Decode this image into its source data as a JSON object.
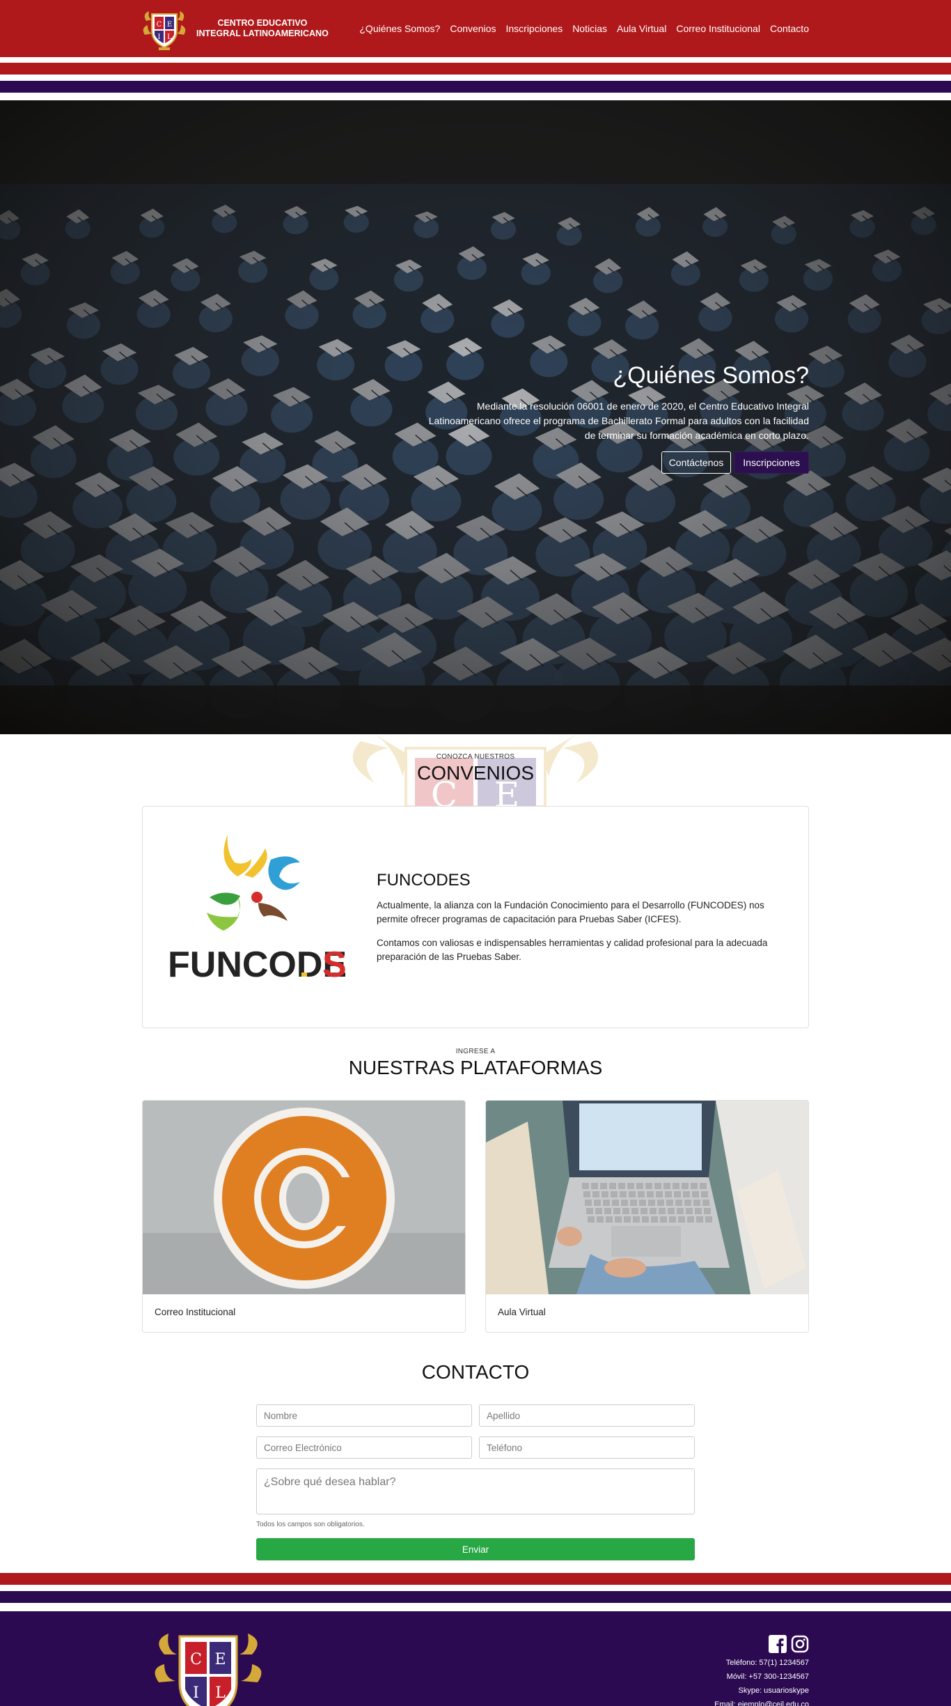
{
  "brand": {
    "name_line1": "CENTRO EDUCATIVO",
    "name_line2": "INTEGRAL LATINOAMERICANO",
    "crest_letters": [
      "C",
      "E",
      "I",
      "L"
    ]
  },
  "nav": {
    "items": [
      {
        "label": "¿Quiénes Somos?"
      },
      {
        "label": "Convenios"
      },
      {
        "label": "Inscripciones"
      },
      {
        "label": "Noticias"
      },
      {
        "label": "Aula Virtual"
      },
      {
        "label": "Correo Institucional"
      },
      {
        "label": "Contacto"
      }
    ]
  },
  "colors": {
    "primary_red": "#b0191b",
    "primary_purple": "#2b0f4f",
    "success_green": "#28a745"
  },
  "hero": {
    "title": "¿Quiénes Somos?",
    "text": "Mediante la resolución 06001 de enero de 2020, el Centro Educativo Integral Latinoamericano ofrece el programa de Bachillerato Formal para adultos con la facilidad de terminar su formación académica en corto plazo.",
    "button_contact": "Contáctenos",
    "button_register": "Inscripciones"
  },
  "convenios": {
    "kicker": "CONOZCA NUESTROS",
    "title": "CONVENIOS",
    "card": {
      "logo_text_main": "FUNCODE",
      "logo_text_s": "S",
      "heading": "FUNCODES",
      "paragraph1": "Actualmente, la alianza con la Fundación Conocimiento para el Desarrollo (FUNCODES) nos permite ofrecer programas de capacitación para Pruebas Saber (ICFES).",
      "paragraph2": "Contamos con valiosas e indispensables herramientas y calidad profesional para la adecuada preparación de las Pruebas Saber."
    }
  },
  "plataformas": {
    "kicker": "INGRESE A",
    "title": "NUESTRAS PLATAFORMAS",
    "cards": [
      {
        "label": "Correo Institucional",
        "image": "at-sign-icon"
      },
      {
        "label": "Aula Virtual",
        "image": "laptop-photo"
      }
    ]
  },
  "contacto": {
    "title": "CONTACTO",
    "fields": {
      "nombre": "Nombre",
      "apellido": "Apellido",
      "correo": "Correo Electrónico",
      "telefono": "Teléfono",
      "mensaje": "¿Sobre qué desea hablar?"
    },
    "help": "Todos los campos son obligatorios.",
    "submit": "Enviar"
  },
  "footer": {
    "telefono": "Teléfono: 57(1) 1234567",
    "movil": "Móvil: +57 300-1234567",
    "skype": "Skype: usuarioskype",
    "email": "Email: ejemplo@ceil.edu.co",
    "social": [
      "facebook-icon",
      "instagram-icon"
    ]
  }
}
